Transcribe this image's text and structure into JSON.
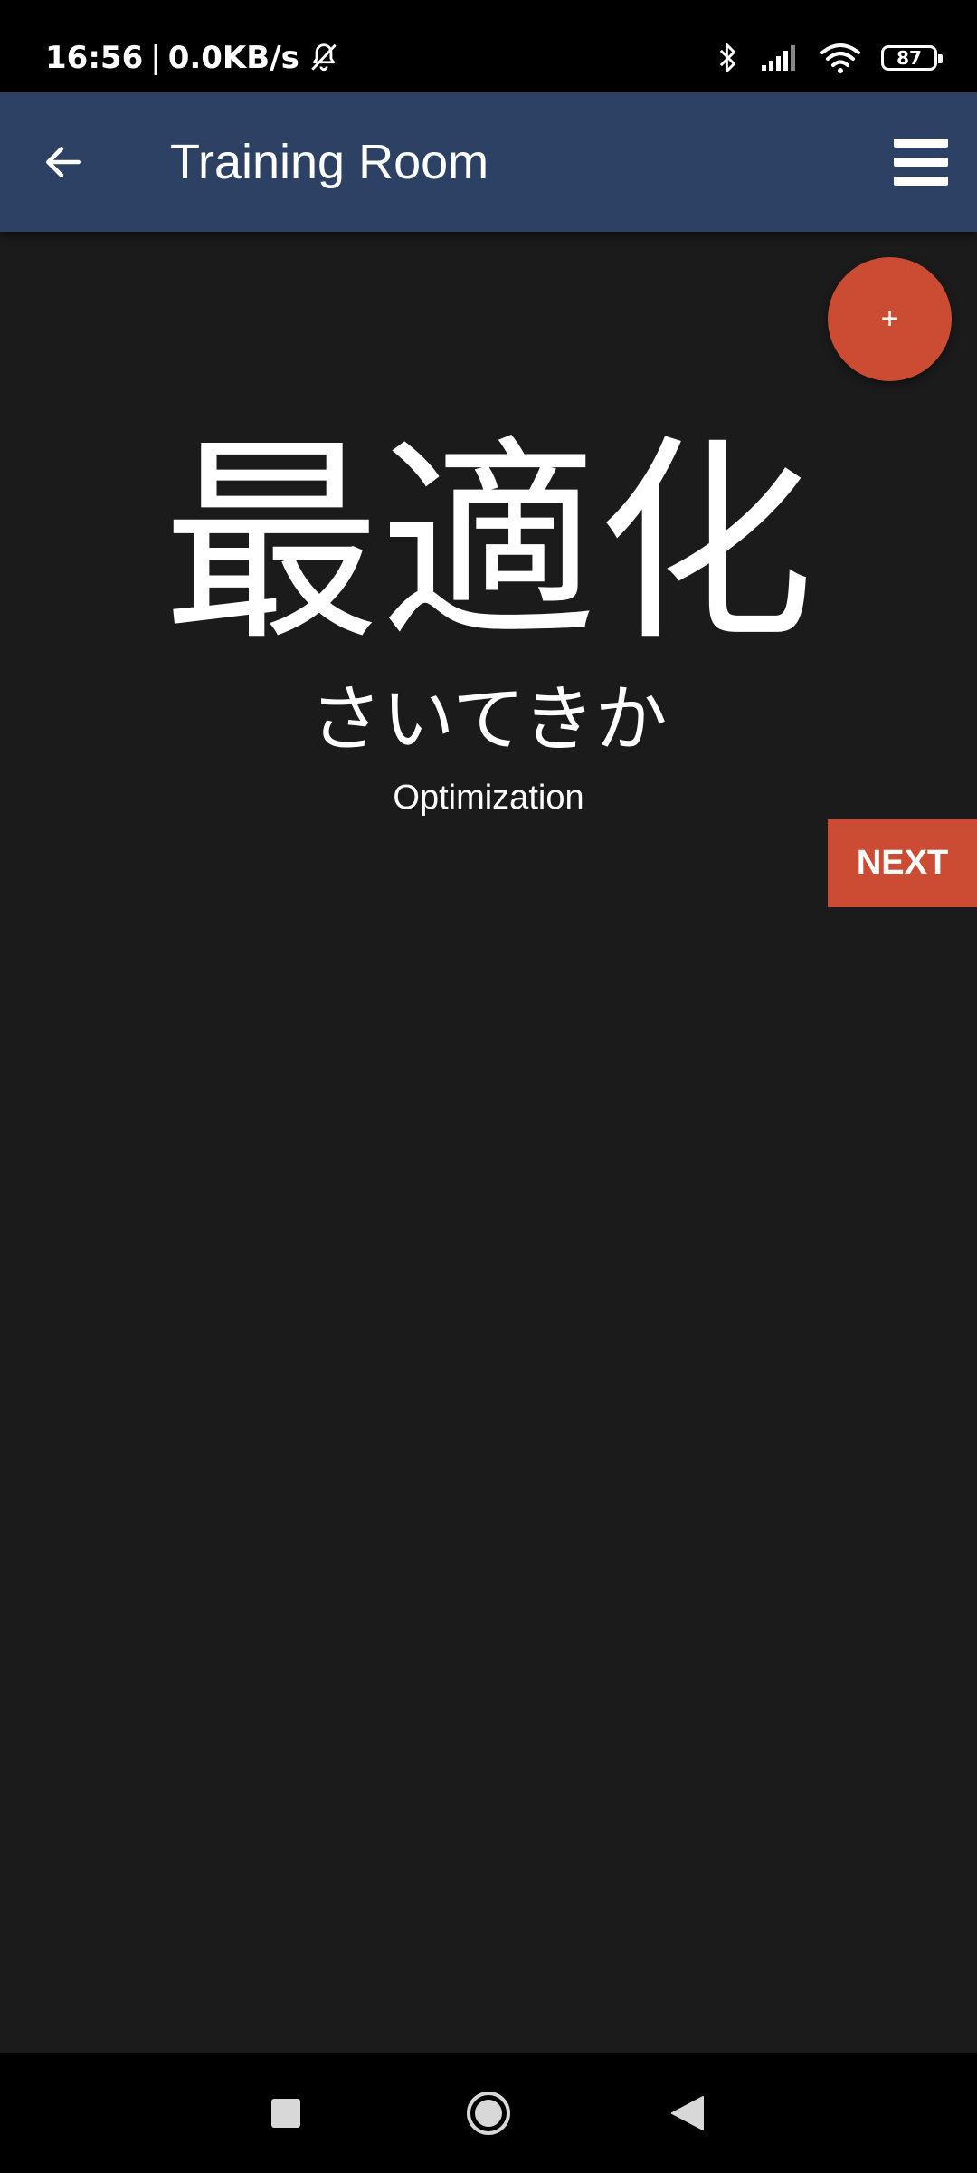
{
  "status_bar": {
    "time": "16:56",
    "separator": "|",
    "net_speed": "0.0KB/s",
    "battery": "87",
    "icons": [
      "mute-bell-icon",
      "bluetooth-icon",
      "signal-icon",
      "wifi-icon",
      "battery-icon"
    ]
  },
  "app_bar": {
    "title": "Training Room",
    "back_icon": "arrow-left-icon",
    "menu_icon": "hamburger-menu-icon",
    "color": "#2c4163"
  },
  "fab": {
    "label": "+",
    "color": "#cc4b33"
  },
  "card": {
    "kanji": "最適化",
    "reading": "さいてきか",
    "meaning": "Optimization"
  },
  "next_button": {
    "label": "NEXT",
    "color": "#cc4b33"
  },
  "nav_bar": {
    "icons": [
      "recents-square-icon",
      "home-circle-icon",
      "back-triangle-icon"
    ]
  }
}
